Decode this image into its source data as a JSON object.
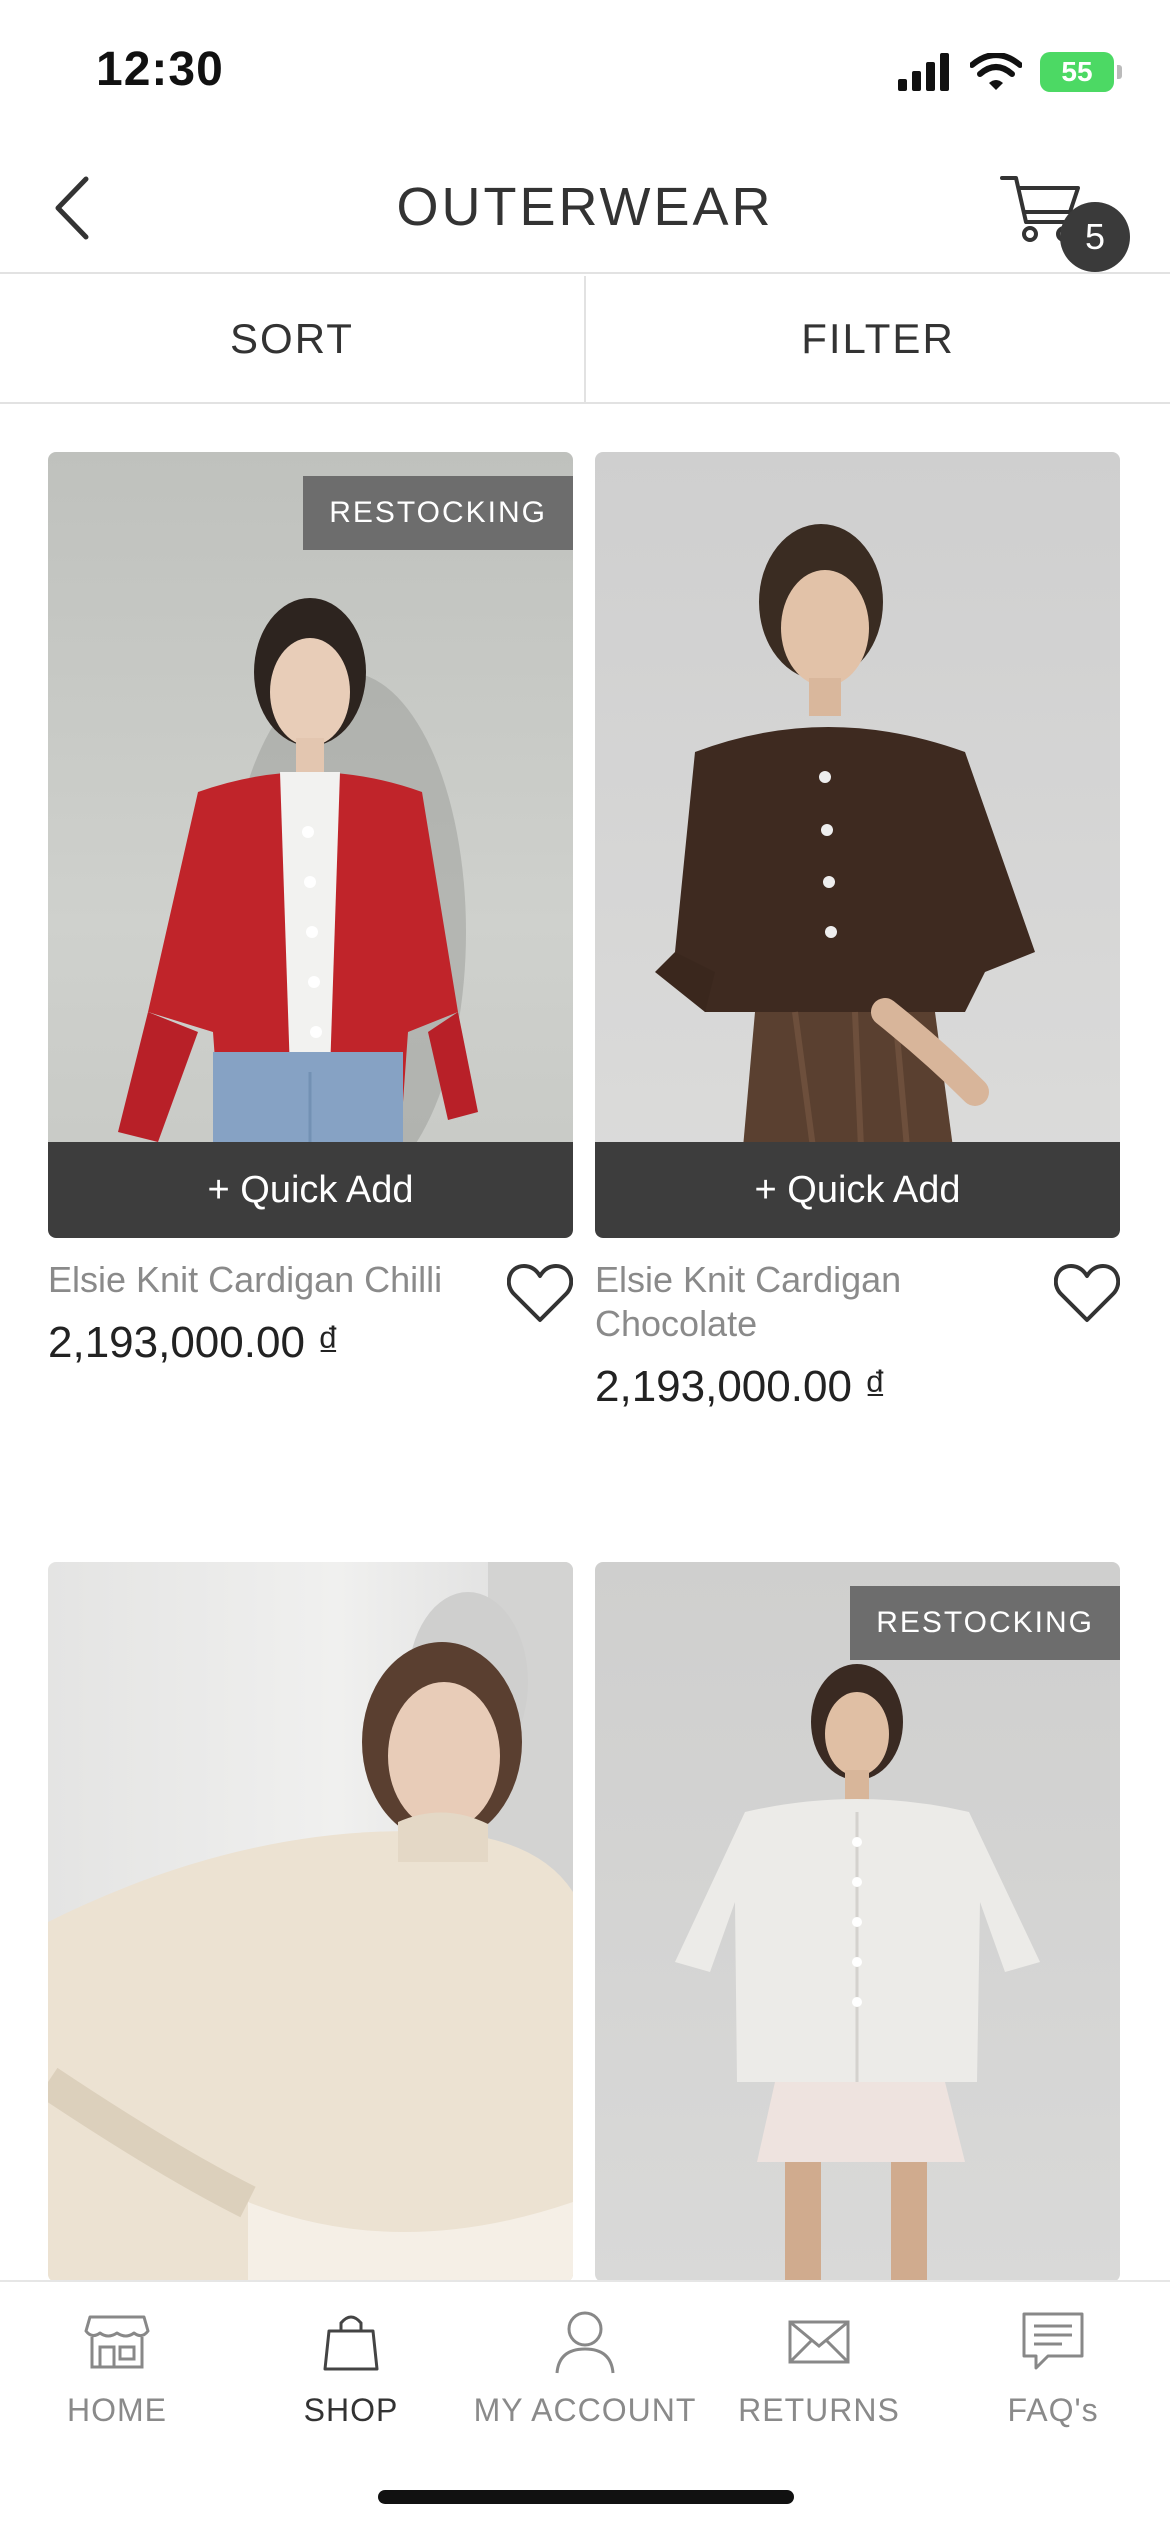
{
  "status_bar": {
    "time": "12:30",
    "battery": "55"
  },
  "header": {
    "title": "OUTERWEAR",
    "cart_count": "5"
  },
  "toolbar": {
    "sort_label": "SORT",
    "filter_label": "FILTER"
  },
  "quick_add_label": "+ Quick Add",
  "products": [
    {
      "name": "Elsie Knit Cardigan Chilli",
      "price": "2,193,000.00 ₫",
      "badge": "RESTOCKING"
    },
    {
      "name": "Elsie Knit Cardigan Chocolate",
      "price": "2,193,000.00 ₫",
      "badge": ""
    },
    {
      "name": "",
      "price": "",
      "badge": ""
    },
    {
      "name": "",
      "price": "",
      "badge": "RESTOCKING"
    }
  ],
  "tabs": [
    {
      "label": "HOME",
      "icon": "storefront-icon"
    },
    {
      "label": "SHOP",
      "icon": "shopping-bag-icon"
    },
    {
      "label": "MY ACCOUNT",
      "icon": "user-icon"
    },
    {
      "label": "RETURNS",
      "icon": "envelope-icon"
    },
    {
      "label": "FAQ's",
      "icon": "chat-icon"
    }
  ],
  "colors": {
    "accent_dark": "#3d3d3d",
    "badge_gray": "#6d6d6d",
    "battery_green": "#4cd964"
  }
}
